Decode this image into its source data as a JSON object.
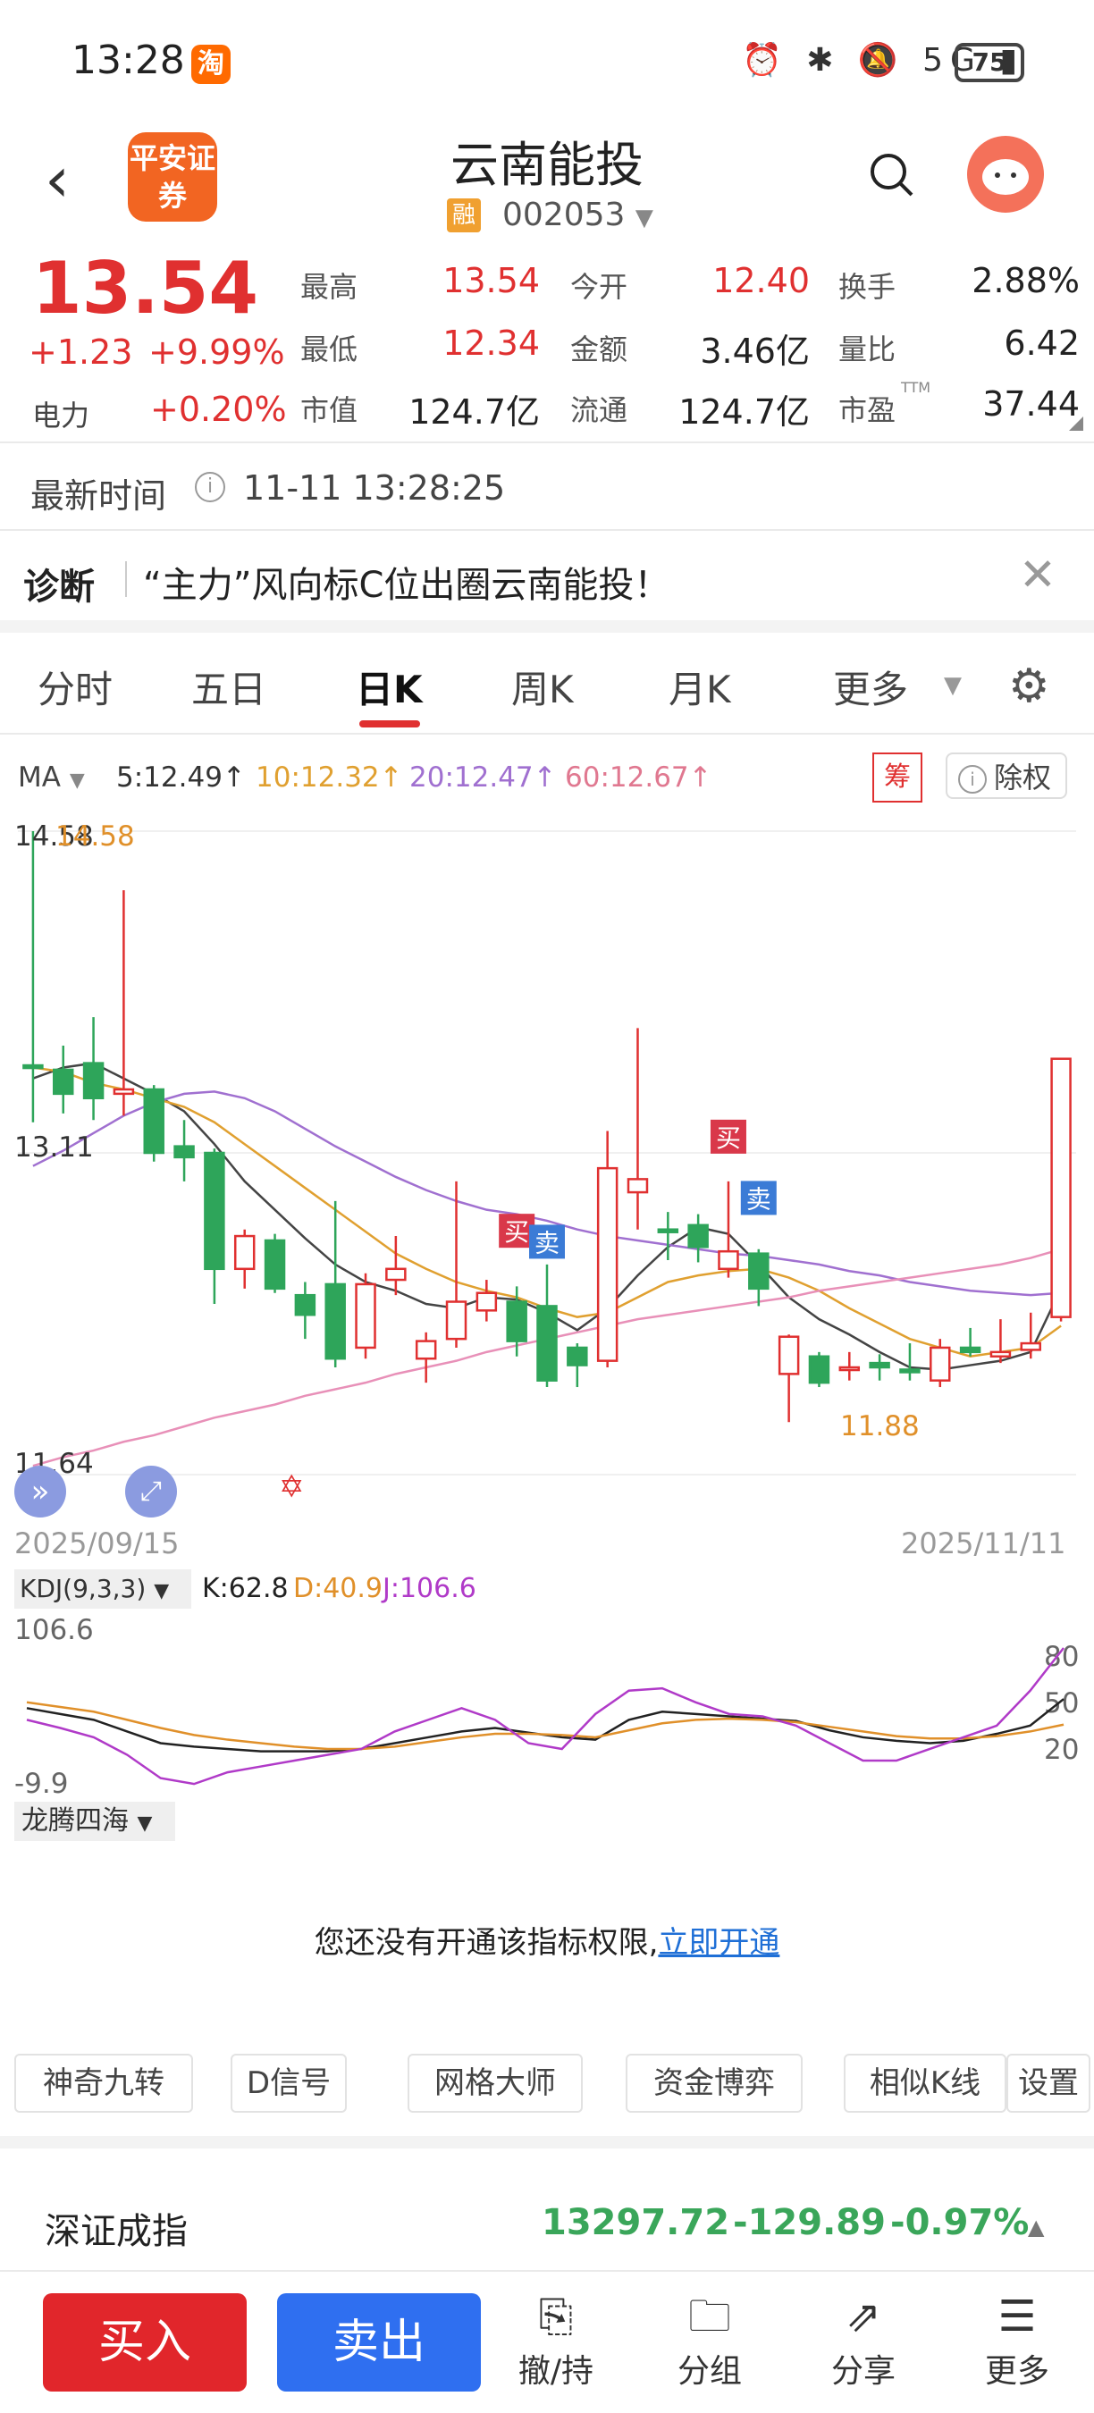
{
  "status_bar": {
    "time": "13:28",
    "app_badge": "淘",
    "battery": "75",
    "icons": "⏰ ✱ 🔕 5G ▮"
  },
  "header": {
    "stock_name": "云南能投",
    "tag": "融",
    "code": "002053",
    "broker_logo_text": "平安证券"
  },
  "quote": {
    "price": "13.54",
    "change": "+1.23",
    "change_pct": "+9.99%",
    "sector": "电力",
    "sector_pct": "+0.20%",
    "fields": [
      {
        "label": "最高",
        "value": "13.54",
        "color": "#e03030"
      },
      {
        "label": "今开",
        "value": "12.40",
        "color": "#e03030"
      },
      {
        "label": "换手",
        "value": "2.88%",
        "color": "#222222"
      },
      {
        "label": "最低",
        "value": "12.34",
        "color": "#e03030"
      },
      {
        "label": "金额",
        "value": "3.46亿",
        "color": "#222222"
      },
      {
        "label": "量比",
        "value": "6.42",
        "color": "#222222"
      },
      {
        "label": "市值",
        "value": "124.7亿",
        "color": "#222222"
      },
      {
        "label": "流通",
        "value": "124.7亿",
        "color": "#222222"
      },
      {
        "label": "市盈",
        "value": "37.44",
        "color": "#222222",
        "superscript": "TTM"
      }
    ]
  },
  "update": {
    "label": "最新时间",
    "value": "11-11 13:28:25"
  },
  "diagnosis": {
    "label": "诊断",
    "text": "“主力”风向标C位出圈云南能投！"
  },
  "tabs": [
    "分时",
    "五日",
    "日K",
    "周K",
    "月K",
    "更多"
  ],
  "active_tab": "日K",
  "ma": {
    "label": "MA",
    "ma5": "5:12.49↑",
    "ma10": "10:12.32↑",
    "ma20": "20:12.47↑",
    "ma60": "60:12.67↑",
    "chou": "筹",
    "chuquan": "除权"
  },
  "kline_axis": {
    "high": "14.58",
    "high_marker": "14.58",
    "mid": "13.11",
    "low": "11.64",
    "low_marker": "11.88",
    "start_date": "2025/09/15",
    "end_date": "2025/11/11"
  },
  "signals": {
    "buy": "买",
    "sell": "卖"
  },
  "kdj": {
    "title": "KDJ(9,3,3)",
    "k": "K:62.8",
    "d": "D:40.9",
    "j": "J:106.6",
    "top": "106.6",
    "bottom": "-9.9",
    "l80": "80",
    "l50": "50",
    "l20": "20"
  },
  "indicator2": {
    "title": "龙腾四海",
    "notice": "您还没有开通该指标权限,",
    "notice_link": "立即开通"
  },
  "tools": [
    "神奇九转",
    "D信号",
    "网格大师",
    "资金博弈",
    "相似K线",
    "设置"
  ],
  "index": {
    "name": "深证成指",
    "value": "13297.72",
    "change": "-129.89",
    "pct": "-0.97%"
  },
  "bottom_bar": {
    "buy": "买入",
    "sell": "卖出",
    "nav": [
      {
        "icon": "undo-hold-icon",
        "label": "撤/持"
      },
      {
        "icon": "folder-icon",
        "label": "分组"
      },
      {
        "icon": "share-icon",
        "label": "分享"
      },
      {
        "icon": "menu-icon",
        "label": "更多"
      }
    ]
  },
  "chart_data": [
    {
      "type": "candlestick",
      "title": "",
      "x_range": [
        "2025/09/15",
        "2025/11/11"
      ],
      "ylim": [
        11.64,
        14.58
      ],
      "candles": [
        {
          "o": 13.51,
          "c": 13.5,
          "h": 14.58,
          "l": 13.25
        },
        {
          "o": 13.49,
          "c": 13.38,
          "h": 13.6,
          "l": 13.29
        },
        {
          "o": 13.52,
          "c": 13.36,
          "h": 13.73,
          "l": 13.26
        },
        {
          "o": 13.38,
          "c": 13.4,
          "h": 14.31,
          "l": 13.28
        },
        {
          "o": 13.4,
          "c": 13.11,
          "h": 13.42,
          "l": 13.07
        },
        {
          "o": 13.14,
          "c": 13.09,
          "h": 13.26,
          "l": 12.98
        },
        {
          "o": 13.11,
          "c": 12.58,
          "h": 13.13,
          "l": 12.42
        },
        {
          "o": 12.58,
          "c": 12.73,
          "h": 12.76,
          "l": 12.49
        },
        {
          "o": 12.71,
          "c": 12.49,
          "h": 12.74,
          "l": 12.47
        },
        {
          "o": 12.46,
          "c": 12.37,
          "h": 12.52,
          "l": 12.26
        },
        {
          "o": 12.51,
          "c": 12.17,
          "h": 12.89,
          "l": 12.13
        },
        {
          "o": 12.22,
          "c": 12.51,
          "h": 12.56,
          "l": 12.17
        },
        {
          "o": 12.53,
          "c": 12.58,
          "h": 12.73,
          "l": 12.46
        },
        {
          "o": 12.17,
          "c": 12.25,
          "h": 12.29,
          "l": 12.06
        },
        {
          "o": 12.26,
          "c": 12.43,
          "h": 12.98,
          "l": 12.22
        },
        {
          "o": 12.39,
          "c": 12.47,
          "h": 12.53,
          "l": 12.34
        },
        {
          "o": 12.43,
          "c": 12.25,
          "h": 12.5,
          "l": 12.18
        },
        {
          "o": 12.41,
          "c": 12.07,
          "h": 12.6,
          "l": 12.04
        },
        {
          "o": 12.22,
          "c": 12.14,
          "h": 12.24,
          "l": 12.04
        },
        {
          "o": 12.16,
          "c": 13.04,
          "h": 13.21,
          "l": 12.13
        },
        {
          "o": 12.93,
          "c": 12.99,
          "h": 13.68,
          "l": 12.76
        },
        {
          "o": 12.76,
          "c": 12.75,
          "h": 12.84,
          "l": 12.62
        },
        {
          "o": 12.78,
          "c": 12.68,
          "h": 12.83,
          "l": 12.61
        },
        {
          "o": 12.58,
          "c": 12.66,
          "h": 12.98,
          "l": 12.54
        },
        {
          "o": 12.65,
          "c": 12.49,
          "h": 12.67,
          "l": 12.41
        },
        {
          "o": 12.1,
          "c": 12.27,
          "h": 12.28,
          "l": 11.88
        },
        {
          "o": 12.18,
          "c": 12.06,
          "h": 12.2,
          "l": 12.04
        },
        {
          "o": 12.13,
          "c": 12.13,
          "h": 12.2,
          "l": 12.07
        },
        {
          "o": 12.15,
          "c": 12.13,
          "h": 12.19,
          "l": 12.07
        },
        {
          "o": 12.12,
          "c": 12.11,
          "h": 12.24,
          "l": 12.07
        },
        {
          "o": 12.07,
          "c": 12.22,
          "h": 12.26,
          "l": 12.04
        },
        {
          "o": 12.22,
          "c": 12.2,
          "h": 12.31,
          "l": 12.18
        },
        {
          "o": 12.18,
          "c": 12.2,
          "h": 12.35,
          "l": 12.15
        },
        {
          "o": 12.21,
          "c": 12.24,
          "h": 12.38,
          "l": 12.17
        },
        {
          "o": 12.36,
          "c": 13.54,
          "h": 13.54,
          "l": 12.34
        }
      ],
      "series": [
        {
          "name": "MA5",
          "color": "#444444",
          "values": [
            13.45,
            13.5,
            13.52,
            13.45,
            13.38,
            13.3,
            13.15,
            12.98,
            12.85,
            12.72,
            12.6,
            12.52,
            12.48,
            12.42,
            12.4,
            12.45,
            12.44,
            12.38,
            12.3,
            12.4,
            12.55,
            12.68,
            12.77,
            12.74,
            12.6,
            12.45,
            12.35,
            12.28,
            12.2,
            12.13,
            12.12,
            12.14,
            12.16,
            12.2,
            12.49
          ]
        },
        {
          "name": "MA10",
          "color": "#e0a030",
          "values": [
            13.5,
            13.48,
            13.43,
            13.4,
            13.36,
            13.32,
            13.25,
            13.15,
            13.05,
            12.95,
            12.85,
            12.75,
            12.65,
            12.58,
            12.52,
            12.48,
            12.45,
            12.4,
            12.36,
            12.38,
            12.45,
            12.52,
            12.55,
            12.57,
            12.58,
            12.54,
            12.48,
            12.4,
            12.33,
            12.26,
            12.22,
            12.18,
            12.2,
            12.22,
            12.32
          ]
        },
        {
          "name": "MA20",
          "color": "#a070d0",
          "values": [
            13.05,
            13.12,
            13.2,
            13.28,
            13.34,
            13.38,
            13.39,
            13.36,
            13.3,
            13.22,
            13.14,
            13.07,
            13,
            12.94,
            12.89,
            12.85,
            12.83,
            12.8,
            12.76,
            12.73,
            12.71,
            12.69,
            12.67,
            12.65,
            12.64,
            12.62,
            12.6,
            12.57,
            12.55,
            12.52,
            12.5,
            12.48,
            12.47,
            12.46,
            12.47
          ]
        },
        {
          "name": "MA60",
          "color": "#e890b8",
          "values": [
            11.68,
            11.72,
            11.75,
            11.79,
            11.82,
            11.86,
            11.9,
            11.93,
            11.96,
            12,
            12.03,
            12.06,
            12.1,
            12.13,
            12.16,
            12.2,
            12.23,
            12.26,
            12.29,
            12.32,
            12.35,
            12.37,
            12.39,
            12.41,
            12.43,
            12.45,
            12.48,
            12.5,
            12.52,
            12.54,
            12.56,
            12.58,
            12.6,
            12.63,
            12.67
          ]
        }
      ]
    },
    {
      "type": "line",
      "title": "KDJ(9,3,3)",
      "ylim": [
        -9.9,
        106.6
      ],
      "series": [
        {
          "name": "K",
          "color": "#222222",
          "values": [
            55,
            50,
            45,
            35,
            25,
            22,
            20,
            18,
            18,
            18,
            20,
            25,
            30,
            35,
            38,
            34,
            30,
            28,
            45,
            52,
            50,
            48,
            46,
            44,
            36,
            30,
            27,
            25,
            27,
            33,
            40,
            62.8
          ]
        },
        {
          "name": "D",
          "color": "#e0902a",
          "values": [
            60,
            56,
            52,
            45,
            38,
            32,
            28,
            25,
            22,
            20,
            20,
            22,
            26,
            30,
            33,
            33,
            32,
            30,
            36,
            42,
            45,
            46,
            45,
            43,
            39,
            35,
            31,
            29,
            29,
            31,
            35,
            40.9
          ]
        },
        {
          "name": "J",
          "color": "#b03ac8",
          "values": [
            45,
            38,
            30,
            15,
            -5,
            -10,
            0,
            5,
            10,
            15,
            20,
            35,
            45,
            55,
            45,
            25,
            20,
            50,
            70,
            72,
            60,
            50,
            48,
            40,
            25,
            10,
            10,
            20,
            30,
            40,
            70,
            106.6
          ]
        }
      ]
    }
  ]
}
